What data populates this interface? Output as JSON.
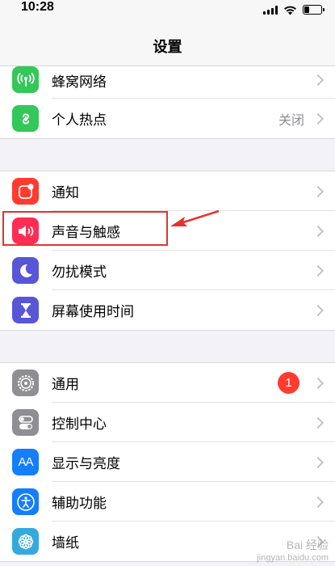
{
  "status": {
    "time": "10:28"
  },
  "nav": {
    "title": "设置"
  },
  "groups": [
    {
      "rows": [
        {
          "label": "蜂窝网络",
          "icon": "cellular-icon",
          "color": "#34c759"
        },
        {
          "label": "个人热点",
          "icon": "hotspot-icon",
          "color": "#34c759",
          "value": "关闭"
        }
      ]
    },
    {
      "rows": [
        {
          "label": "通知",
          "icon": "notification-icon",
          "color": "#ff3b30"
        },
        {
          "label": "声音与触感",
          "icon": "sound-icon",
          "color": "#ff2d55"
        },
        {
          "label": "勿扰模式",
          "icon": "moon-icon",
          "color": "#5856d6"
        },
        {
          "label": "屏幕使用时间",
          "icon": "hourglass-icon",
          "color": "#5856d6"
        }
      ]
    },
    {
      "rows": [
        {
          "label": "通用",
          "icon": "gear-icon",
          "color": "#8e8e93",
          "badge": "1"
        },
        {
          "label": "控制中心",
          "icon": "toggles-icon",
          "color": "#8e8e93"
        },
        {
          "label": "显示与亮度",
          "icon": "display-icon",
          "color": "#147efb",
          "icon_text": "AA"
        },
        {
          "label": "辅助功能",
          "icon": "accessibility-icon",
          "color": "#147efb"
        },
        {
          "label": "墙纸",
          "icon": "wallpaper-icon",
          "color": "#34aadc"
        }
      ]
    }
  ],
  "annotation": {
    "highlight_color": "#e5322f"
  },
  "watermark": {
    "line1": "Bai 经验",
    "line2": "jingyan.baidu.com"
  }
}
